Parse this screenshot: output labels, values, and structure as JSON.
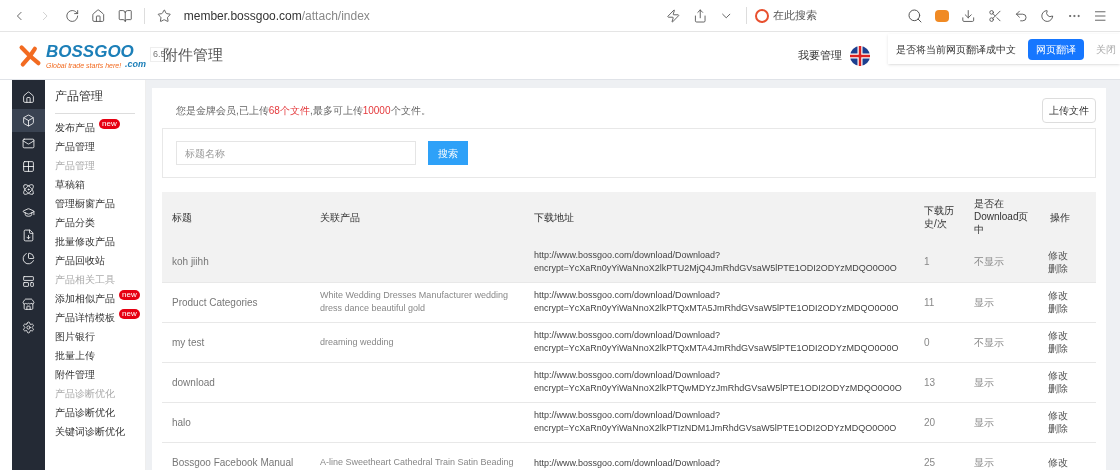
{
  "browser": {
    "url_host": "member.bossgoo.com",
    "url_path": "/attach/index",
    "search_placeholder": "在此搜索"
  },
  "translate_bar": {
    "prompt": "是否将当前网页翻译成中文",
    "translate_button": "网页翻译",
    "close": "关闭"
  },
  "header": {
    "logo": "BOSSGOO",
    "logo_suffix": ".com",
    "tagline": "Global trade starts here!",
    "version": "6.5",
    "page_title": "附件管理",
    "manage_link": "我要管理"
  },
  "rail": [
    {
      "selected": false
    },
    {
      "selected": true
    },
    {
      "selected": false
    },
    {
      "selected": false
    },
    {
      "selected": false
    },
    {
      "selected": false
    },
    {
      "selected": false
    },
    {
      "selected": false
    },
    {
      "selected": false
    },
    {
      "selected": false
    },
    {
      "selected": false
    }
  ],
  "sidebar": {
    "title": "产品管理",
    "items": [
      {
        "kind": "link",
        "label": "发布产品",
        "badge": "new"
      },
      {
        "kind": "link",
        "label": "产品管理"
      },
      {
        "kind": "group",
        "label": "产品管理"
      },
      {
        "kind": "link",
        "label": "草稿箱"
      },
      {
        "kind": "link",
        "label": "管理橱窗产品"
      },
      {
        "kind": "link",
        "label": "产品分类"
      },
      {
        "kind": "link",
        "label": "批量修改产品"
      },
      {
        "kind": "link",
        "label": "产品回收站"
      },
      {
        "kind": "group",
        "label": "产品相关工具"
      },
      {
        "kind": "link",
        "label": "添加相似产品",
        "badge": "new"
      },
      {
        "kind": "link",
        "label": "产品详情模板",
        "badge": "new"
      },
      {
        "kind": "link",
        "label": "图片银行"
      },
      {
        "kind": "link",
        "label": "批量上传"
      },
      {
        "kind": "link",
        "label": "附件管理"
      },
      {
        "kind": "group",
        "label": "产品诊断优化"
      },
      {
        "kind": "link",
        "label": "产品诊断优化"
      },
      {
        "kind": "link",
        "label": "关键词诊断优化"
      }
    ]
  },
  "notice": [
    {
      "text": "您是金牌会员,已上传",
      "highlight": false
    },
    {
      "text": "68个文件",
      "highlight": true
    },
    {
      "text": ",最多可上传",
      "highlight": false
    },
    {
      "text": "10000",
      "highlight": true
    },
    {
      "text": "个文件。",
      "highlight": false
    }
  ],
  "upload_button": "上传文件",
  "search": {
    "placeholder": "标题名称",
    "button": "搜索"
  },
  "table": {
    "columns": [
      "标题",
      "关联产品",
      "下载地址",
      "下载历史/次",
      "是否在Download页中",
      "操作"
    ],
    "rows": [
      {
        "selected": true,
        "title": "koh jiihh",
        "product": "",
        "url": [
          "http://www.bossgoo.com/download/Download?",
          "encrypt=YcXaRn0yYiWaNnoX2lkPTU2MjQ4JmRhdGVsaW5lPTE1ODI2ODYzMDQO0O0O"
        ],
        "downloads": "1",
        "display": "不显示",
        "edit": "修改",
        "delete": "删除"
      },
      {
        "selected": false,
        "title": "Product Categories",
        "product": "White Wedding Dresses Manufacturer wedding dress dance beautiful gold",
        "url": [
          "http://www.bossgoo.com/download/Download?",
          "encrypt=YcXaRn0yYiWaNnoX2lkPTQxMTA5JmRhdGVsaW5lPTE1ODI2ODYzMDQO0O0O"
        ],
        "downloads": "11",
        "display": "显示",
        "edit": "修改",
        "delete": "删除"
      },
      {
        "selected": false,
        "title": "my test",
        "product": "dreaming wedding",
        "url": [
          "http://www.bossgoo.com/download/Download?",
          "encrypt=YcXaRn0yYiWaNnoX2lkPTQxMTA4JmRhdGVsaW5lPTE1ODI2ODYzMDQO0O0O"
        ],
        "downloads": "0",
        "display": "不显示",
        "edit": "修改",
        "delete": "删除"
      },
      {
        "selected": false,
        "title": "download",
        "product": "",
        "url": [
          "http://www.bossgoo.com/download/Download?",
          "encrypt=YcXaRn0yYiWaNnoX2lkPTQwMDYzJmRhdGVsaW5lPTE1ODI2ODYzMDQO0O0O"
        ],
        "downloads": "13",
        "display": "显示",
        "edit": "修改",
        "delete": "删除"
      },
      {
        "selected": false,
        "title": "halo",
        "product": "",
        "url": [
          "http://www.bossgoo.com/download/Download?",
          "encrypt=YcXaRn0yYiWaNnoX2lkPTIzNDM1JmRhdGVsaW5lPTE1ODI2ODYzMDQO0O0O"
        ],
        "downloads": "20",
        "display": "显示",
        "edit": "修改",
        "delete": "删除"
      },
      {
        "selected": false,
        "title": "Bossgoo Facebook Manual",
        "product": "A-line Sweetheart Cathedral Train Satin Beading",
        "url": [
          "http://www.bossgoo.com/download/Download?"
        ],
        "downloads": "25",
        "display": "显示",
        "edit": "修改"
      }
    ]
  }
}
